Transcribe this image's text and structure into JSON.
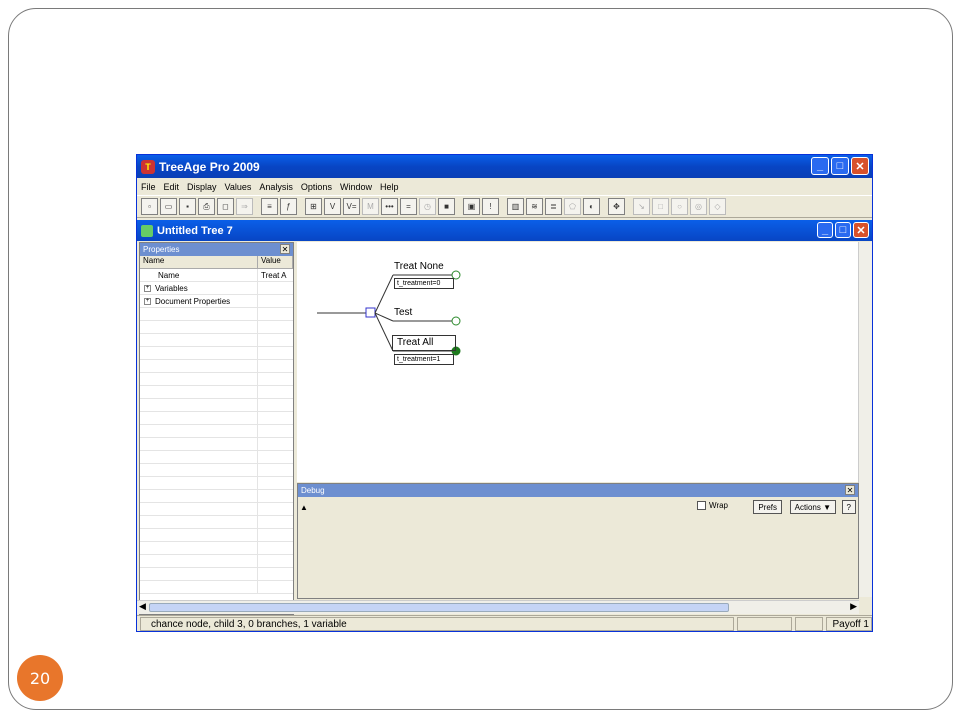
{
  "slide": {
    "page_number": "20"
  },
  "app": {
    "title": "TreeAge Pro 2009"
  },
  "menu": [
    "File",
    "Edit",
    "Display",
    "Values",
    "Analysis",
    "Options",
    "Window",
    "Help"
  ],
  "toolbar_icons": [
    "new-file-icon",
    "open-folder-icon",
    "save-icon",
    "print-icon",
    "print-preview-icon",
    "export-icon",
    "sort-nodes-icon",
    "function-icon",
    "tree-icon",
    "variables-icon",
    "variable-define-icon",
    "markov-icon",
    "ellipsis-icon",
    "equals-icon",
    "timer-icon",
    "color-icon",
    "report-icon",
    "warning-icon",
    "bar-chart-icon",
    "sens-icon",
    "sens2-icon",
    "polygon-icon",
    "tornado-icon",
    "move-icon",
    "arrow-icon",
    "square-node-icon",
    "circle-node-icon",
    "terminal-node-icon",
    "diamond-node-icon"
  ],
  "document": {
    "title": "Untitled Tree 7"
  },
  "properties": {
    "title": "Properties",
    "col_name": "Name",
    "col_value": "Value",
    "rows": [
      {
        "name": "Name",
        "value": "Treat A"
      },
      {
        "name": "Variables",
        "value": ""
      },
      {
        "name": "Document Properties",
        "value": ""
      }
    ]
  },
  "tree": {
    "branches": [
      {
        "label": "Treat None",
        "definition": "t_treatment=0"
      },
      {
        "label": "Test",
        "definition": ""
      },
      {
        "label": "Treat All",
        "definition": "t_treatment=1"
      }
    ]
  },
  "debug": {
    "title": "Debug",
    "wrap_label": "Wrap",
    "prefs_label": "Prefs",
    "actions_label": "Actions ▼",
    "help_label": "?"
  },
  "status": {
    "message": "chance node, child 3, 0 branches, 1 variable",
    "payoff": "Payoff 1"
  }
}
